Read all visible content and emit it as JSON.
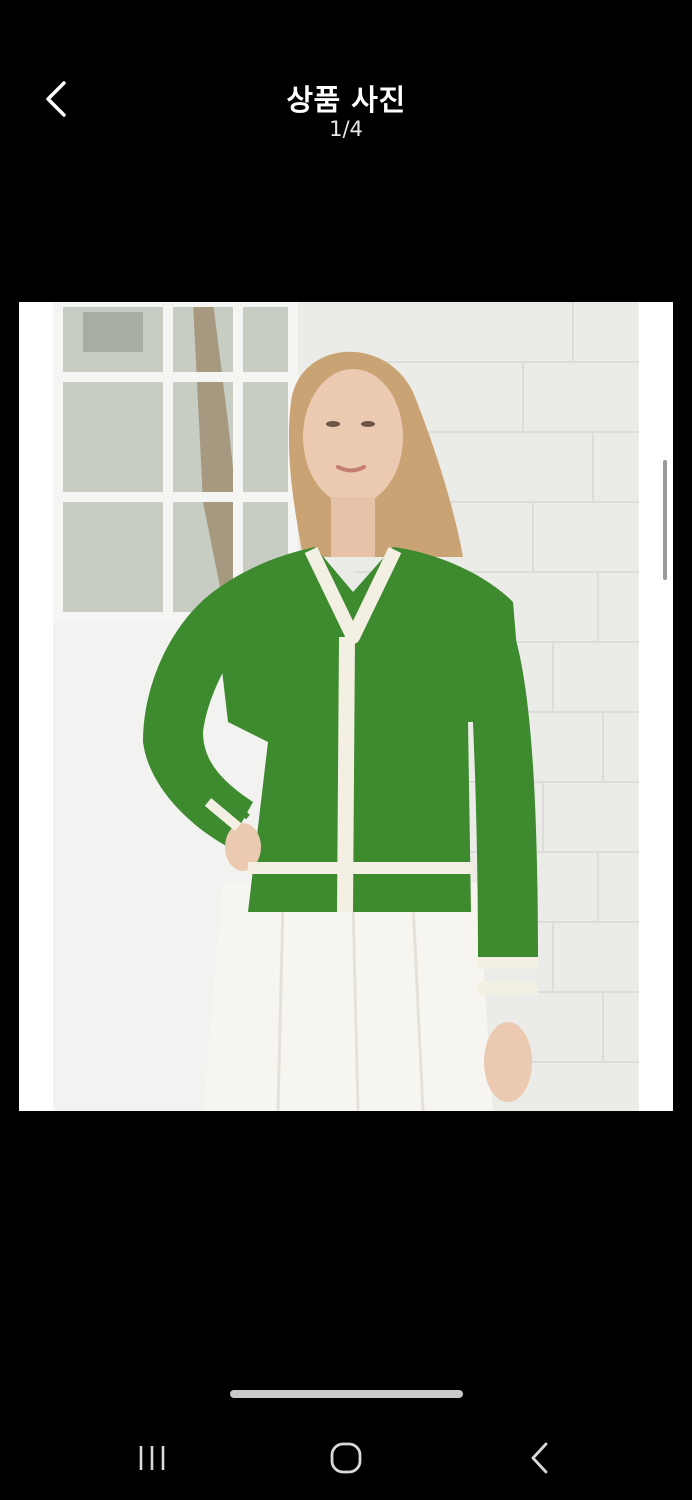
{
  "header": {
    "title": "상품 사진",
    "counter": "1/4",
    "back_icon": "chevron-left-icon"
  },
  "viewer": {
    "image": "green-cardigan-product-photo",
    "colors": {
      "cardigan": "#3d8a2f",
      "trim": "#f3efe2",
      "skirt": "#f7f5f0",
      "background": "#ececea"
    }
  },
  "navbar": {
    "recents_icon": "recent-apps-icon",
    "home_icon": "home-icon",
    "back_icon": "back-arrow-icon"
  }
}
